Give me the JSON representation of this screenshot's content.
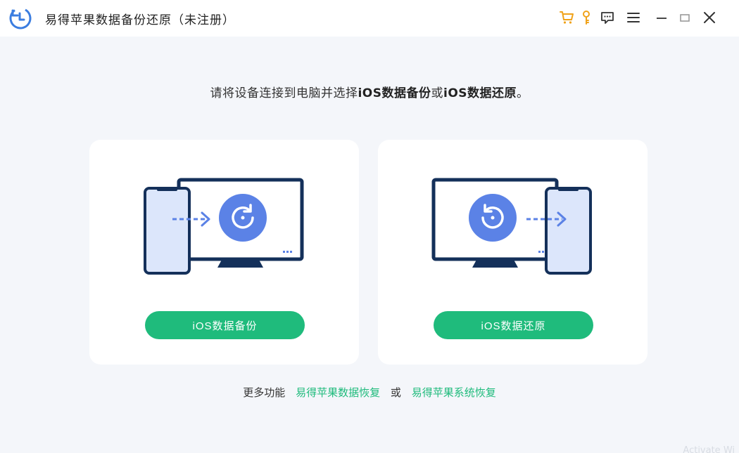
{
  "titlebar": {
    "title": "易得苹果数据备份还原（未注册）",
    "icons": [
      "app-logo-icon",
      "cart-icon",
      "key-icon",
      "feedback-icon",
      "menu-icon",
      "minimize-icon",
      "maximize-icon",
      "close-icon"
    ]
  },
  "instruction": {
    "prefix": "请将设备连接到电脑并选择",
    "option1": "iOS数据备份",
    "middle": "或",
    "option2": "iOS数据还原",
    "suffix": "。"
  },
  "cards": [
    {
      "button_label": "iOS数据备份",
      "illustration": "phone-to-computer-backup"
    },
    {
      "button_label": "iOS数据还原",
      "illustration": "computer-to-phone-restore"
    }
  ],
  "more": {
    "lead": "更多功能",
    "link1": "易得苹果数据恢复",
    "separator": "或",
    "link2": "易得苹果系统恢复"
  },
  "watermark": "Activate Wi",
  "colors": {
    "accent_green": "#1fbb7c",
    "illustration_navy": "#14305a",
    "illustration_blue": "#5b82e6",
    "phone_fill": "#dce6fb",
    "toolbar_orange": "#f0a21a"
  }
}
